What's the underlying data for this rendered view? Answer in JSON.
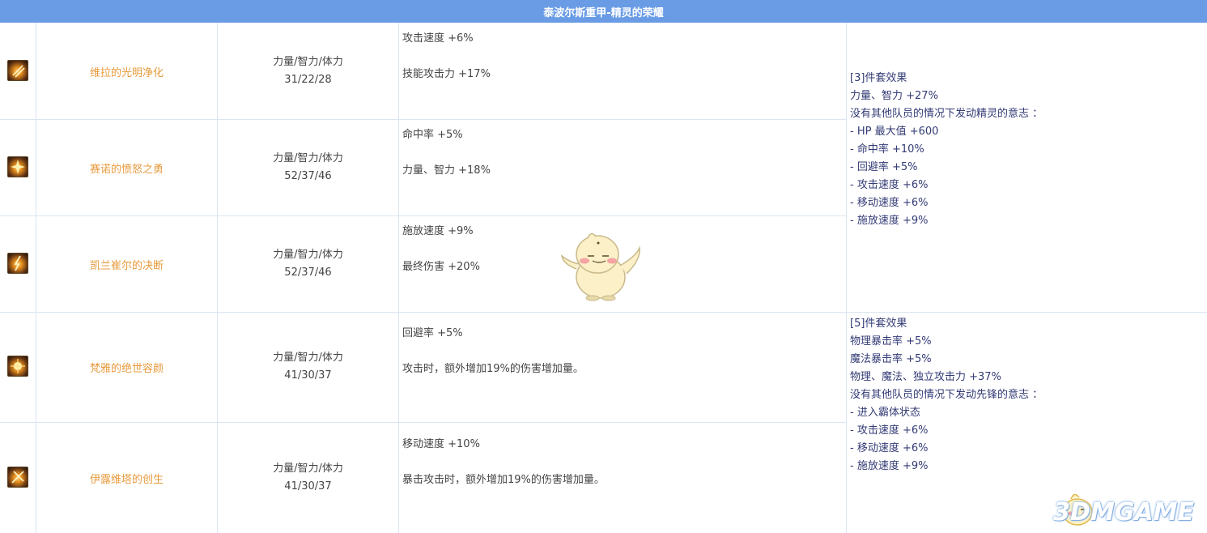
{
  "header": {
    "title": "泰波尔斯重甲-精灵的荣耀"
  },
  "items": [
    {
      "icon": "equipment-icon",
      "name": "维拉的光明净化",
      "stat_label": "力量/智力/体力",
      "stat_value": "31/22/28",
      "effect1": "攻击速度 +6%",
      "effect2": "技能攻击力 +17%"
    },
    {
      "icon": "equipment-icon",
      "name": "赛诺的愤怒之勇",
      "stat_label": "力量/智力/体力",
      "stat_value": "52/37/46",
      "effect1": "命中率 +5%",
      "effect2": "力量、智力 +18%"
    },
    {
      "icon": "equipment-icon",
      "name": "凯兰崔尔的决断",
      "stat_label": "力量/智力/体力",
      "stat_value": "52/37/46",
      "effect1": "施放速度 +9%",
      "effect2": "最终伤害 +20%"
    },
    {
      "icon": "equipment-icon",
      "name": "梵雅的绝世容颜",
      "stat_label": "力量/智力/体力",
      "stat_value": "41/30/37",
      "effect1": "回避率 +5%",
      "effect2": "攻击时，额外增加19%的伤害增加量。"
    },
    {
      "icon": "equipment-icon",
      "name": "伊露维塔的创生",
      "stat_label": "力量/智力/体力",
      "stat_value": "41/30/37",
      "effect1": "移动速度 +10%",
      "effect2": "暴击攻击时，额外增加19%的伤害增加量。"
    }
  ],
  "set3": {
    "lines": [
      "[3]件套效果",
      "力量、智力 +27%",
      "没有其他队员的情况下发动精灵的意志 ：",
      "- HP 最大值 +600",
      "- 命中率 +10%",
      "- 回避率 +5%",
      "- 攻击速度 +6%",
      "- 移动速度 +6%",
      "- 施放速度 +9%"
    ]
  },
  "set5": {
    "lines": [
      "[5]件套效果",
      "物理暴击率 +5%",
      "魔法暴击率 +5%",
      "物理、魔法、独立攻击力 +37%",
      "没有其他队员的情况下发动先锋的意志 ：",
      "- 进入霸体状态",
      "- 攻击速度 +6%",
      "- 移动速度 +6%",
      "- 施放速度 +9%"
    ]
  },
  "watermark": {
    "brand": "3DMGAME"
  },
  "colors": {
    "header_bg": "#6a9ce6",
    "item_name": "#e89a3c",
    "set_text": "#333b76",
    "grid_line": "#dbe6f1"
  }
}
